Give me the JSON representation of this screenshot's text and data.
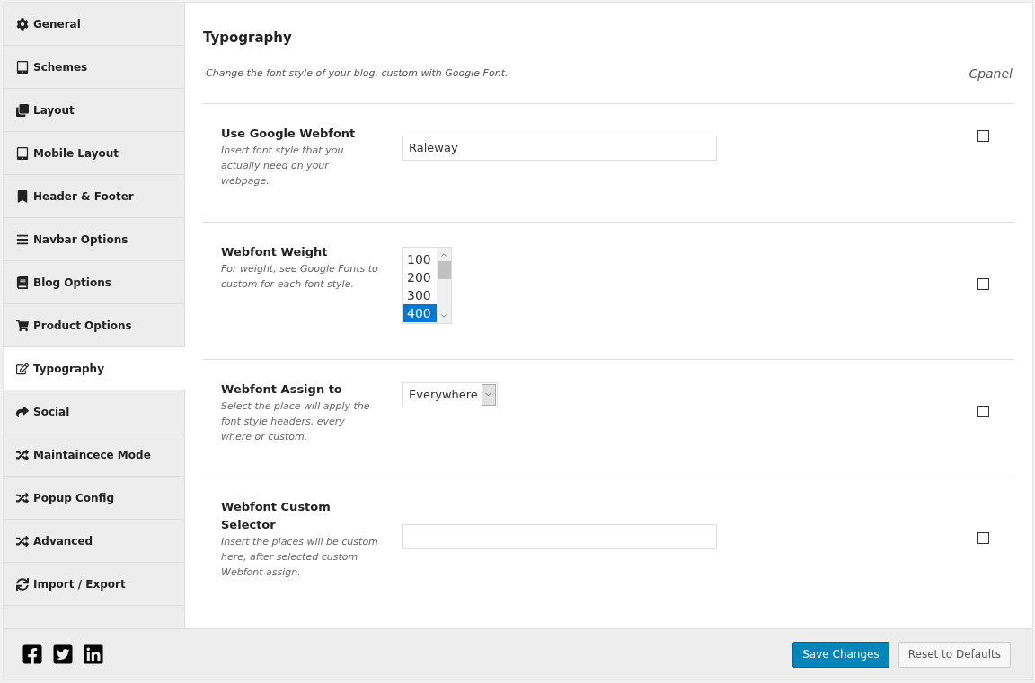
{
  "sidebar": {
    "items": [
      {
        "label": "General",
        "selected": false
      },
      {
        "label": "Schemes",
        "selected": false
      },
      {
        "label": "Layout",
        "selected": false
      },
      {
        "label": "Mobile Layout",
        "selected": false
      },
      {
        "label": "Header & Footer",
        "selected": false
      },
      {
        "label": "Navbar Options",
        "selected": false
      },
      {
        "label": "Blog Options",
        "selected": false
      },
      {
        "label": "Product Options",
        "selected": false
      },
      {
        "label": "Typography",
        "selected": true
      },
      {
        "label": "Social",
        "selected": false
      },
      {
        "label": "Maintaincece Mode",
        "selected": false
      },
      {
        "label": "Popup Config",
        "selected": false
      },
      {
        "label": "Advanced",
        "selected": false
      },
      {
        "label": "Import / Export",
        "selected": false
      }
    ]
  },
  "section": {
    "title": "Typography",
    "description": "Change the font style of your blog, custom with Google Font.",
    "brand": "Cpanel"
  },
  "fields": [
    {
      "kind": "text",
      "label": "Use Google Webfont",
      "help": "Insert font style that you actually need on your webpage.",
      "value": "Raleway",
      "checked": false
    },
    {
      "kind": "listbox",
      "label": "Webfont Weight",
      "help": "For weight, see Google Fonts to custom for each font style.",
      "options": [
        {
          "label": "100",
          "selected": false
        },
        {
          "label": "200",
          "selected": false
        },
        {
          "label": "300",
          "selected": false
        },
        {
          "label": "400",
          "selected": true
        }
      ],
      "checked": false
    },
    {
      "kind": "select",
      "label": "Webfont Assign to",
      "help": "Select the place will apply the font style headers, every where or custom.",
      "value": "Everywhere",
      "checked": false
    },
    {
      "kind": "text",
      "label": "Webfont Custom Selector",
      "help": "Insert the places will be custom here, after selected custom Webfont assign.",
      "checked": false
    }
  ],
  "footer": {
    "buttons": [
      {
        "kind": "primary",
        "label": "Save Changes"
      },
      {
        "kind": "secondary",
        "label": "Reset to Defaults"
      }
    ]
  }
}
